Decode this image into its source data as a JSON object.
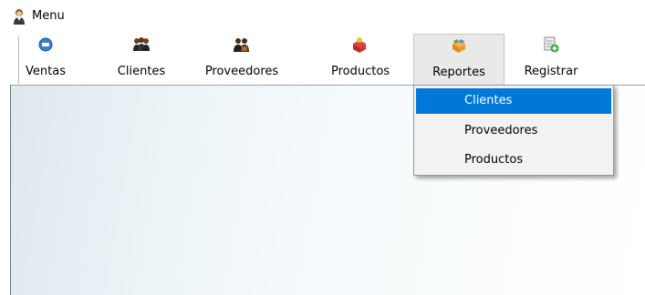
{
  "window": {
    "title": "Menu",
    "icon": "user-icon"
  },
  "toolbar": {
    "items": [
      {
        "label": "Ventas",
        "icon": "sales-icon"
      },
      {
        "label": "Clientes",
        "icon": "clients-icon"
      },
      {
        "label": "Proveedores",
        "icon": "suppliers-icon"
      },
      {
        "label": "Productos",
        "icon": "products-icon"
      },
      {
        "label": "Reportes",
        "icon": "reports-icon",
        "pressed": true
      },
      {
        "label": "Registrar",
        "icon": "register-icon"
      }
    ]
  },
  "reportes_menu": {
    "items": [
      {
        "label": "Clientes",
        "highlighted": true
      },
      {
        "label": "Proveedores"
      },
      {
        "label": "Productos"
      }
    ]
  },
  "colors": {
    "highlight": "#0078d7",
    "pressed_button": "#e9e9ea",
    "menu_background": "#f2f2f2"
  }
}
